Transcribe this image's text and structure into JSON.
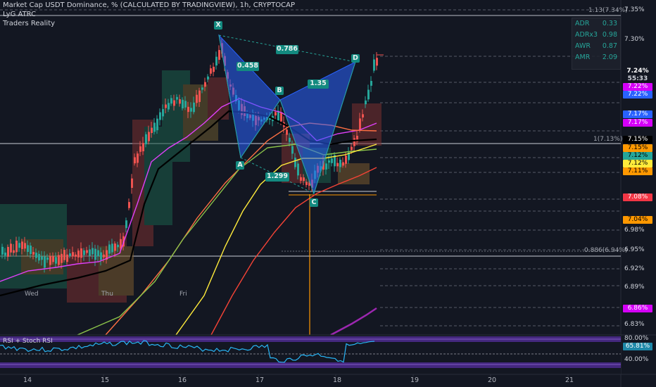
{
  "header": {
    "title": "Market Cap USDT Dominance, % (CALCULATED BY TRADINGVIEW), 1h, CRYPTOCAP",
    "indicator_1": "LyG ATRC",
    "indicator_2": "Traders Reality"
  },
  "atr_panel": [
    {
      "key": "ADR",
      "value": "0.33"
    },
    {
      "key": "ADRx3",
      "value": "0.98"
    },
    {
      "key": "AWR",
      "value": "0.87"
    },
    {
      "key": "AMR",
      "value": "2.09"
    }
  ],
  "price_axis": {
    "ticks": [
      "7.35%",
      "7.30%",
      "6.98%",
      "6.95%",
      "6.92%",
      "6.89%",
      "6.83%"
    ],
    "tags": [
      {
        "label": "7.24%",
        "bg": "#131722",
        "fg": "#ffffff"
      },
      {
        "label": "55:33",
        "bg": "#131722",
        "fg": "#d1d4dc"
      },
      {
        "label": "7.22%",
        "bg": "#d500f9",
        "fg": "#ffffff"
      },
      {
        "label": "7.22%",
        "bg": "#2962ff",
        "fg": "#ffffff"
      },
      {
        "label": "7.17%",
        "bg": "#2962ff",
        "fg": "#ffffff"
      },
      {
        "label": "7.17%",
        "bg": "#d500f9",
        "fg": "#ffffff"
      },
      {
        "label": "7.15%",
        "bg": "#000000",
        "fg": "#ffffff"
      },
      {
        "label": "7.15%",
        "bg": "#ff9800",
        "fg": "#000000"
      },
      {
        "label": "7.12%",
        "bg": "#26a69a",
        "fg": "#000000"
      },
      {
        "label": "7.12%",
        "bg": "#ffeb3b",
        "fg": "#000000"
      },
      {
        "label": "7.11%",
        "bg": "#ff9800",
        "fg": "#000000"
      },
      {
        "label": "7.08%",
        "bg": "#f23645",
        "fg": "#ffffff"
      },
      {
        "label": "7.04%",
        "bg": "#ff9800",
        "fg": "#000000"
      },
      {
        "label": "6.86%",
        "bg": "#d500f9",
        "fg": "#ffffff"
      }
    ],
    "fib_labels": [
      "1.13(7.34%)",
      "1(7.13%)",
      "0.886(6.94%)"
    ]
  },
  "pattern": {
    "points": [
      "X",
      "A",
      "B",
      "C",
      "D"
    ],
    "ratios": [
      "0.786",
      "0.458",
      "1.35",
      "1.299"
    ]
  },
  "day_labels": [
    "Wed",
    "Thu",
    "Fri"
  ],
  "rsi": {
    "title": "RSI + Stoch RSI",
    "upper": "80.00%",
    "value": "65.81%",
    "lower": "40.00%"
  },
  "x_axis": [
    "14",
    "15",
    "16",
    "17",
    "18",
    "19",
    "20",
    "21"
  ],
  "colors": {
    "background": "#131722",
    "bull": "#26a69a",
    "bear": "#ef5350",
    "pattern": "#2962ff"
  }
}
